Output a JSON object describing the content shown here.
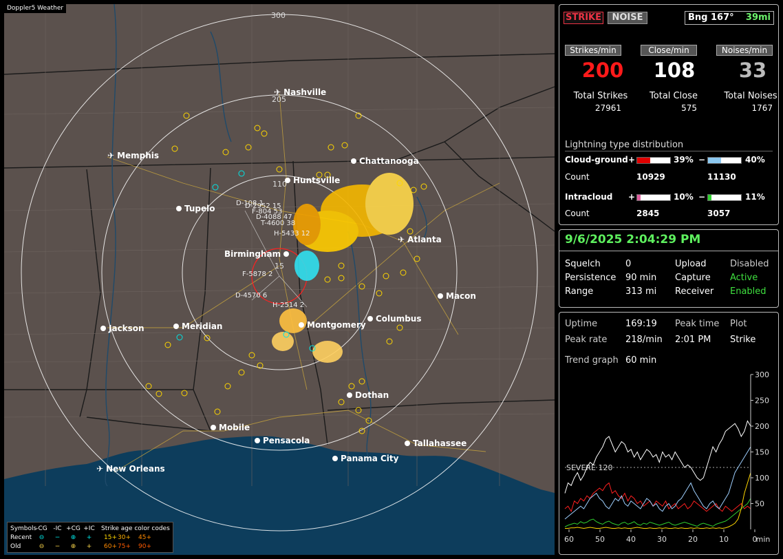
{
  "app": {
    "title": "Doppler5 Weather"
  },
  "map": {
    "ring_labels": {
      "r300": "300",
      "r205": "205",
      "r110": "110",
      "r15": "15"
    },
    "cities": {
      "nashville": "Nashville",
      "memphis": "Memphis",
      "chattanooga": "Chattanooga",
      "huntsville": "Huntsville",
      "tupelo": "Tupelo",
      "atlanta": "Atlanta",
      "birmingham": "Birmingham",
      "macon": "Macon",
      "jackson": "Jackson",
      "meridian": "Meridian",
      "montgomery": "Montgomery",
      "columbus": "Columbus",
      "dothan": "Dothan",
      "mobile": "Mobile",
      "pensacola": "Pensacola",
      "tallahassee": "Tallahassee",
      "panama_city": "Panama City",
      "new_orleans": "New Orleans"
    },
    "strike_labels": {
      "l1": "D-108 1",
      "l2": "D-2952 15",
      "l3": "F-804 53",
      "l4": "D-4088 47",
      "l5": "T-4600 38",
      "l6": "H-5433 12",
      "l7": "F-5878 2",
      "l8": "D-4570 6",
      "l9": "H-2514 2"
    }
  },
  "legend": {
    "title_symbols": "Symbols",
    "cols": [
      "-CG",
      "-IC",
      "+CG",
      "+IC"
    ],
    "title_age": "Strike age color codes",
    "recent": "Recent",
    "old": "Old",
    "recent_ages": [
      "15+",
      "30+",
      "45+"
    ],
    "old_ages": [
      "60+",
      "75+",
      "90+"
    ],
    "sym_neg_cg": "⊖",
    "sym_neg_ic": "−",
    "sym_pos_cg": "⊕",
    "sym_pos_ic": "+"
  },
  "panel1": {
    "strike_btn": "STRIKE",
    "noise_btn": "NOISE",
    "bearing": "Bng 167°",
    "range": "39mi",
    "rates": {
      "strikes_label": "Strikes/min",
      "close_label": "Close/min",
      "noises_label": "Noises/min",
      "strikes": "200",
      "close": "108",
      "noises": "33"
    },
    "totals": {
      "strikes_label": "Total Strikes",
      "close_label": "Total Close",
      "noises_label": "Total Noises",
      "strikes": "27961",
      "close": "575",
      "noises": "1767"
    },
    "distribution": {
      "title": "Lightning type distribution",
      "cg_label": "Cloud-ground",
      "ic_label": "Intracloud",
      "count_label": "Count",
      "cg_pos_pct": "39%",
      "cg_neg_pct": "40%",
      "ic_pos_pct": "10%",
      "ic_neg_pct": "11%",
      "cg_pos_count": "10929",
      "cg_neg_count": "11130",
      "ic_pos_count": "2845",
      "ic_neg_count": "3057",
      "plus": "+",
      "minus": "−",
      "colors": {
        "cg_pos": "#e00000",
        "cg_neg": "#8cc8f0",
        "ic_pos": "#e060a0",
        "ic_neg": "#2ed02e"
      },
      "fills": {
        "cg_pos": 0.39,
        "cg_neg": 0.4,
        "ic_pos": 0.1,
        "ic_neg": 0.11
      }
    }
  },
  "panel2": {
    "datetime": "9/6/2025 2:04:29 PM",
    "squelch_label": "Squelch",
    "squelch": "0",
    "persistence_label": "Persistence",
    "persistence": "90 min",
    "range_label": "Range",
    "range": "313 mi",
    "upload_label": "Upload",
    "upload": "Disabled",
    "capture_label": "Capture",
    "capture": "Active",
    "receiver_label": "Receiver",
    "receiver": "Enabled"
  },
  "panel3": {
    "uptime_label": "Uptime",
    "uptime": "169:19",
    "peak_time_label": "Peak time",
    "peak_time": "2:01 PM",
    "plot_label": "Plot",
    "plot": "Strike",
    "peak_rate_label": "Peak rate",
    "peak_rate": "218/min",
    "trend_label": "Trend graph",
    "trend_window": "60 min",
    "severe_label": "SEVERE 120"
  },
  "chart_data": {
    "type": "line",
    "x_ticks": [
      "60",
      "50",
      "40",
      "30",
      "20",
      "10",
      "0"
    ],
    "x_unit": "min",
    "y_ticks": [
      "50",
      "100",
      "150",
      "200",
      "250",
      "300"
    ],
    "ylim": [
      0,
      300
    ],
    "xlim": [
      60,
      0
    ],
    "severe_threshold": 120,
    "series": [
      {
        "color": "#ffffff",
        "values": [
          70,
          90,
          85,
          100,
          110,
          95,
          105,
          120,
          130,
          125,
          140,
          150,
          160,
          175,
          180,
          165,
          150,
          160,
          170,
          165,
          150,
          155,
          140,
          150,
          135,
          145,
          155,
          150,
          140,
          145,
          130,
          150,
          140,
          145,
          135,
          150,
          140,
          130,
          120,
          125,
          120,
          110,
          100,
          95,
          100,
          120,
          140,
          160,
          150,
          165,
          175,
          190,
          195,
          200,
          205,
          195,
          180,
          190,
          210,
          200
        ]
      },
      {
        "color": "#ff2020",
        "values": [
          40,
          45,
          35,
          55,
          50,
          60,
          55,
          65,
          60,
          70,
          75,
          80,
          75,
          85,
          90,
          70,
          75,
          65,
          60,
          70,
          55,
          65,
          60,
          50,
          55,
          45,
          50,
          55,
          45,
          55,
          50,
          45,
          55,
          40,
          45,
          50,
          40,
          45,
          50,
          40,
          45,
          55,
          50,
          45,
          40,
          35,
          40,
          45,
          50,
          40,
          35,
          45,
          40,
          35,
          40,
          45,
          50,
          40,
          45,
          40
        ]
      },
      {
        "color": "#9fd0ff",
        "values": [
          20,
          25,
          30,
          35,
          40,
          45,
          40,
          50,
          60,
          65,
          70,
          60,
          55,
          45,
          40,
          50,
          60,
          55,
          65,
          50,
          45,
          55,
          50,
          45,
          40,
          50,
          60,
          55,
          45,
          50,
          40,
          35,
          45,
          50,
          40,
          45,
          55,
          60,
          70,
          80,
          90,
          75,
          65,
          55,
          45,
          40,
          50,
          55,
          45,
          40,
          50,
          60,
          70,
          90,
          110,
          120,
          130,
          140,
          150,
          160
        ]
      },
      {
        "color": "#30d030",
        "values": [
          5,
          8,
          10,
          12,
          10,
          15,
          12,
          14,
          18,
          20,
          15,
          12,
          10,
          14,
          16,
          12,
          10,
          8,
          12,
          14,
          10,
          12,
          15,
          10,
          8,
          12,
          10,
          14,
          12,
          10,
          8,
          10,
          12,
          14,
          10,
          8,
          10,
          12,
          14,
          12,
          10,
          8,
          6,
          10,
          12,
          10,
          8,
          6,
          10,
          12,
          14,
          16,
          20,
          25,
          30,
          35,
          40,
          45,
          50,
          60
        ]
      },
      {
        "color": "#ffd700",
        "values": [
          2,
          2,
          3,
          3,
          4,
          3,
          2,
          3,
          4,
          3,
          2,
          2,
          3,
          4,
          3,
          2,
          2,
          3,
          2,
          3,
          2,
          2,
          3,
          4,
          3,
          2,
          2,
          3,
          2,
          2,
          3,
          2,
          3,
          2,
          2,
          3,
          2,
          3,
          2,
          2,
          3,
          2,
          3,
          2,
          2,
          3,
          2,
          3,
          2,
          3,
          2,
          3,
          5,
          8,
          12,
          20,
          40,
          70,
          90,
          110
        ]
      }
    ]
  }
}
